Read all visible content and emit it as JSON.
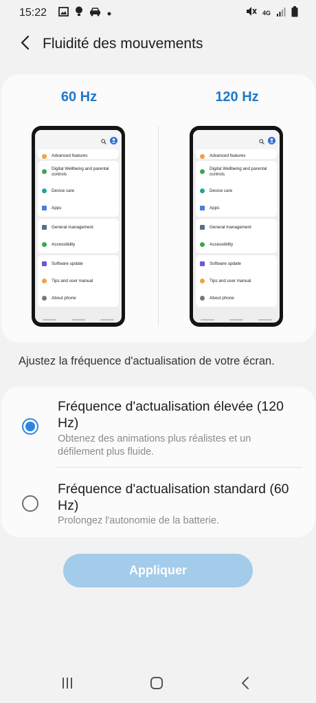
{
  "status_bar": {
    "time": "15:22",
    "network": "4G",
    "icons_left": [
      "image-icon",
      "location-icon",
      "car-icon",
      "dot-icon"
    ],
    "icons_right": [
      "mute-icon",
      "signal-icon",
      "battery-icon"
    ]
  },
  "header": {
    "title": "Fluidité des mouvements",
    "back_icon": "back-arrow-icon"
  },
  "preview": {
    "left_label": "60 Hz",
    "right_label": "120 Hz",
    "phone_items": {
      "advanced": "Advanced features",
      "wellbeing": "Digital Wellbeing and parental controls",
      "device_care": "Device care",
      "apps": "Apps",
      "general": "General management",
      "accessibility": "Accessibility",
      "software": "Software update",
      "tips": "Tips and user manual",
      "about": "About phone"
    }
  },
  "description": "Ajustez la fréquence d'actualisation de votre écran.",
  "options": [
    {
      "title": "Fréquence d'actualisation élevée (120 Hz)",
      "subtitle": "Obtenez des animations plus réalistes et un défilement plus fluide.",
      "selected": true
    },
    {
      "title": "Fréquence d'actualisation standard (60 Hz)",
      "subtitle": "Prolongez l'autonomie de la batterie.",
      "selected": false
    }
  ],
  "apply_button": {
    "label": "Appliquer",
    "enabled": false
  },
  "nav_bar": {
    "icons": [
      "recents-icon",
      "home-icon",
      "back-icon"
    ]
  },
  "colors": {
    "accent": "#1f78c8",
    "radio": "#2b86e0",
    "button_disabled": "#a3cbea"
  }
}
